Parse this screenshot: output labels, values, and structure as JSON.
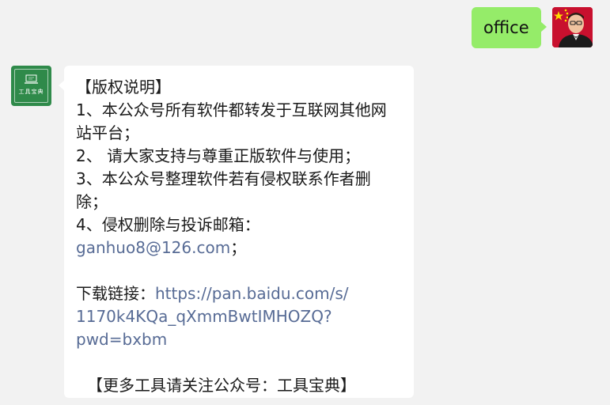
{
  "outgoing": {
    "text": "office"
  },
  "incoming": {
    "avatar_label": "工具宝典",
    "title": "【版权说明】",
    "item1_a": "1、本公众号所有软件都转发于互联网其他网",
    "item1_b": "站平台；",
    "item2": "2、 请大家支持与尊重正版软件与使用；",
    "item3_a": "3、本公众号整理软件若有侵权联系作者删",
    "item3_b": "除；",
    "item4": "4、侵权删除与投诉邮箱：",
    "email": "ganhuo8@126.com",
    "email_suffix": "；",
    "download_label": "下载链接：",
    "download_link_1": "https://pan.baidu.com/s/",
    "download_link_2": "1170k4KQa_qXmmBwtIMHOZQ?",
    "download_link_3": "pwd=bxbm",
    "footer": "【更多工具请关注公众号：工具宝典】"
  },
  "colors": {
    "outgoing_bubble": "#95ec69",
    "incoming_bubble": "#ffffff",
    "link": "#576b95",
    "background": "#f2f2f2",
    "official_avatar": "#2f8a4a"
  },
  "icons": {
    "user_avatar": "user-avatar-photo",
    "official_avatar": "laptop-logo-icon"
  }
}
